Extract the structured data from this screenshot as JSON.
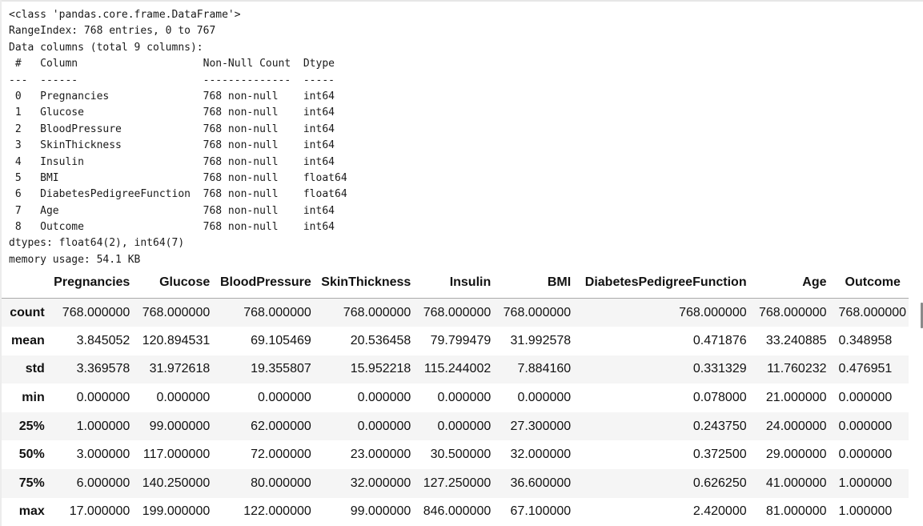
{
  "info_output": {
    "lines": [
      "<class 'pandas.core.frame.DataFrame'>",
      "RangeIndex: 768 entries, 0 to 767",
      "Data columns (total 9 columns):",
      " #   Column                    Non-Null Count  Dtype  ",
      "---  ------                    --------------  -----  ",
      " 0   Pregnancies               768 non-null    int64  ",
      " 1   Glucose                   768 non-null    int64  ",
      " 2   BloodPressure             768 non-null    int64  ",
      " 3   SkinThickness             768 non-null    int64  ",
      " 4   Insulin                   768 non-null    int64  ",
      " 5   BMI                       768 non-null    float64",
      " 6   DiabetesPedigreeFunction  768 non-null    float64",
      " 7   Age                       768 non-null    int64  ",
      " 8   Outcome                   768 non-null    int64  ",
      "dtypes: float64(2), int64(7)",
      "memory usage: 54.1 KB"
    ]
  },
  "describe_table": {
    "columns": [
      "",
      "Pregnancies",
      "Glucose",
      "BloodPressure",
      "SkinThickness",
      "Insulin",
      "BMI",
      "DiabetesPedigreeFunction",
      "Age",
      "Outcome"
    ],
    "rows": [
      {
        "index": "count",
        "values": [
          "768.000000",
          "768.000000",
          "768.000000",
          "768.000000",
          "768.000000",
          "768.000000",
          "768.000000",
          "768.000000",
          "768.000000"
        ]
      },
      {
        "index": "mean",
        "values": [
          "3.845052",
          "120.894531",
          "69.105469",
          "20.536458",
          "79.799479",
          "31.992578",
          "0.471876",
          "33.240885",
          "0.348958"
        ]
      },
      {
        "index": "std",
        "values": [
          "3.369578",
          "31.972618",
          "19.355807",
          "15.952218",
          "115.244002",
          "7.884160",
          "0.331329",
          "11.760232",
          "0.476951"
        ]
      },
      {
        "index": "min",
        "values": [
          "0.000000",
          "0.000000",
          "0.000000",
          "0.000000",
          "0.000000",
          "0.000000",
          "0.078000",
          "21.000000",
          "0.000000"
        ]
      },
      {
        "index": "25%",
        "values": [
          "1.000000",
          "99.000000",
          "62.000000",
          "0.000000",
          "0.000000",
          "27.300000",
          "0.243750",
          "24.000000",
          "0.000000"
        ]
      },
      {
        "index": "50%",
        "values": [
          "3.000000",
          "117.000000",
          "72.000000",
          "23.000000",
          "30.500000",
          "32.000000",
          "0.372500",
          "29.000000",
          "0.000000"
        ]
      },
      {
        "index": "75%",
        "values": [
          "6.000000",
          "140.250000",
          "80.000000",
          "32.000000",
          "127.250000",
          "36.600000",
          "0.626250",
          "41.000000",
          "1.000000"
        ]
      },
      {
        "index": "max",
        "values": [
          "17.000000",
          "199.000000",
          "122.000000",
          "99.000000",
          "846.000000",
          "67.100000",
          "2.420000",
          "81.000000",
          "1.000000"
        ]
      }
    ]
  }
}
